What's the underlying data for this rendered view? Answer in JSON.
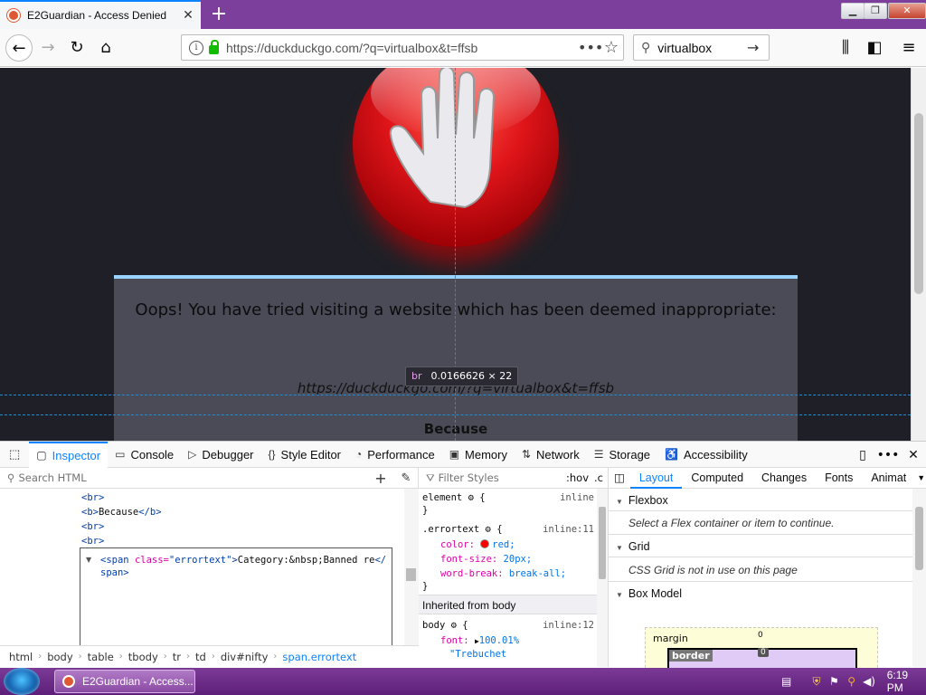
{
  "browser": {
    "tab_title": "E2Guardian - Access Denied",
    "new_tab": "+",
    "url": "https://duckduckgo.com/?q=virtualbox&t=ffsb",
    "search_query": "virtualbox",
    "accent": "#7d3f9c"
  },
  "page": {
    "heading": "Oops! You have tried visiting a website which has been deemed inappropriate:",
    "blocked_url": "https://duckduckgo.com/?q=virtualbox&t=ffsb",
    "because": "Because",
    "tooltip_tag": "br",
    "tooltip_size": "0.0166626 × 22"
  },
  "devtools": {
    "tabs": [
      {
        "label": "Inspector",
        "icon": "inspector-icon"
      },
      {
        "label": "Console",
        "icon": "console-icon"
      },
      {
        "label": "Debugger",
        "icon": "debugger-icon"
      },
      {
        "label": "Style Editor",
        "icon": "style-editor-icon"
      },
      {
        "label": "Performance",
        "icon": "performance-icon"
      },
      {
        "label": "Memory",
        "icon": "memory-icon"
      },
      {
        "label": "Network",
        "icon": "network-icon"
      },
      {
        "label": "Storage",
        "icon": "storage-icon"
      },
      {
        "label": "Accessibility",
        "icon": "accessibility-icon"
      }
    ],
    "search_html_placeholder": "Search HTML",
    "markup": {
      "br1": "<br>",
      "b_open": "<b>",
      "b_text": "Because",
      "b_close": "</b>",
      "br2": "<br>",
      "br3": "<br>",
      "edit_tag": "<span ",
      "edit_attr": "class=",
      "edit_val": "\"errortext\"",
      "edit_close": ">",
      "edit_text": "Category:&nbsp;Banned re",
      "edit_end": "</span>"
    },
    "breadcrumbs": [
      "html",
      "body",
      "table",
      "tbody",
      "tr",
      "td",
      "div#nifty",
      "span.errortext"
    ],
    "rules": {
      "filter_placeholder": "Filter Styles",
      "hov": ":hov",
      "cls": ".c",
      "element_selector": "element",
      "element_src": "inline",
      "errortext_selector": ".errortext",
      "errortext_src": "inline:11",
      "color_prop": "color:",
      "color_val": "red;",
      "fontsize_prop": "font-size:",
      "fontsize_val": "20px;",
      "wordbreak_prop": "word-break:",
      "wordbreak_val": "break-all;",
      "inherited_label": "Inherited from body",
      "body_selector": "body",
      "body_src": "inline:12",
      "font_prop": "font:",
      "font_val": "100.01%",
      "font_val2": "\"Trebuchet"
    },
    "layout": {
      "tabs": [
        "Layout",
        "Computed",
        "Changes",
        "Fonts",
        "Animat"
      ],
      "flexbox": "Flexbox",
      "flexbox_msg": "Select a Flex container or item to continue.",
      "grid": "Grid",
      "grid_msg": "CSS Grid is not in use on this page",
      "boxmodel": "Box Model",
      "margin_label": "margin",
      "margin_val": "0",
      "border_label": "border",
      "border_val": "0"
    }
  },
  "taskbar": {
    "task_label": "E2Guardian - Access...",
    "clock": "6:19 PM"
  }
}
